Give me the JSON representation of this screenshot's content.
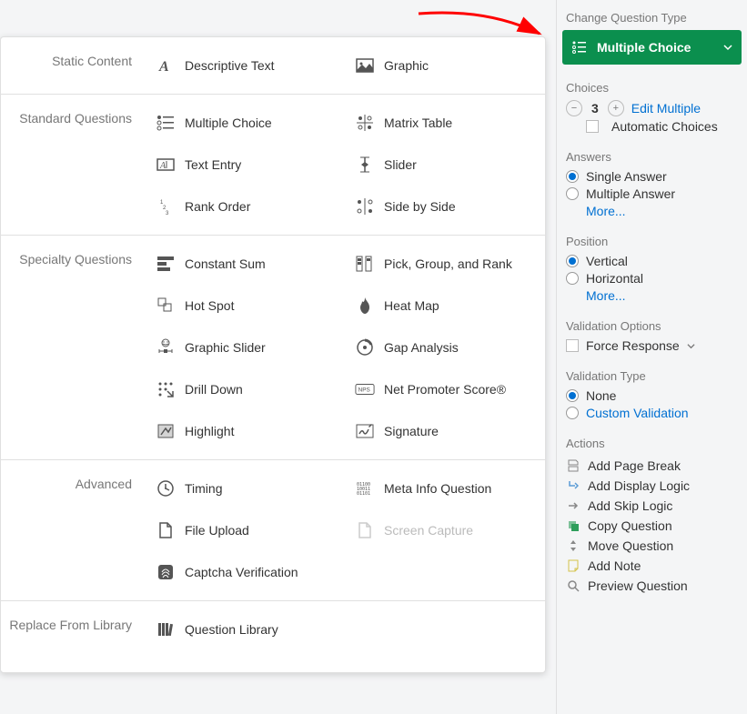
{
  "arrow": {
    "color": "#ff0000"
  },
  "popup": {
    "categories": [
      {
        "name": "static-content",
        "label": "Static Content",
        "options": [
          {
            "key": "descriptive-text",
            "label": "Descriptive Text",
            "icon": "text-icon"
          },
          {
            "key": "graphic",
            "label": "Graphic",
            "icon": "image-icon"
          }
        ]
      },
      {
        "name": "standard-questions",
        "label": "Standard Questions",
        "options": [
          {
            "key": "multiple-choice",
            "label": "Multiple Choice",
            "icon": "mc-icon"
          },
          {
            "key": "matrix-table",
            "label": "Matrix Table",
            "icon": "matrix-icon"
          },
          {
            "key": "text-entry",
            "label": "Text Entry",
            "icon": "textentry-icon"
          },
          {
            "key": "slider",
            "label": "Slider",
            "icon": "slider-icon"
          },
          {
            "key": "rank-order",
            "label": "Rank Order",
            "icon": "rank-icon"
          },
          {
            "key": "side-by-side",
            "label": "Side by Side",
            "icon": "sbs-icon"
          }
        ]
      },
      {
        "name": "specialty-questions",
        "label": "Specialty Questions",
        "options": [
          {
            "key": "constant-sum",
            "label": "Constant Sum",
            "icon": "bars-icon"
          },
          {
            "key": "pick-group-rank",
            "label": "Pick, Group, and Rank",
            "icon": "pgr-icon"
          },
          {
            "key": "hot-spot",
            "label": "Hot Spot",
            "icon": "hotspot-icon"
          },
          {
            "key": "heat-map",
            "label": "Heat Map",
            "icon": "flame-icon"
          },
          {
            "key": "graphic-slider",
            "label": "Graphic Slider",
            "icon": "gslider-icon"
          },
          {
            "key": "gap-analysis",
            "label": "Gap Analysis",
            "icon": "gap-icon"
          },
          {
            "key": "drill-down",
            "label": "Drill Down",
            "icon": "drill-icon"
          },
          {
            "key": "nps",
            "label": "Net Promoter Score®",
            "icon": "nps-icon"
          },
          {
            "key": "highlight",
            "label": "Highlight",
            "icon": "highlight-icon"
          },
          {
            "key": "signature",
            "label": "Signature",
            "icon": "signature-icon"
          }
        ]
      },
      {
        "name": "advanced",
        "label": "Advanced",
        "options": [
          {
            "key": "timing",
            "label": "Timing",
            "icon": "clock-icon"
          },
          {
            "key": "meta-info",
            "label": "Meta Info Question",
            "icon": "meta-icon"
          },
          {
            "key": "file-upload",
            "label": "File Upload",
            "icon": "file-icon"
          },
          {
            "key": "screen-capture",
            "label": "Screen Capture",
            "icon": "file-icon",
            "disabled": true
          },
          {
            "key": "captcha",
            "label": "Captcha Verification",
            "icon": "fingerprint-icon"
          }
        ]
      },
      {
        "name": "replace-from-library",
        "label": "Replace From Library",
        "options": [
          {
            "key": "question-library",
            "label": "Question Library",
            "icon": "library-icon"
          }
        ]
      }
    ]
  },
  "sidebar": {
    "title": "Change Question Type",
    "selected_type": "Multiple Choice",
    "choices": {
      "heading": "Choices",
      "count": "3",
      "edit_multiple": "Edit Multiple",
      "automatic": "Automatic Choices"
    },
    "answers": {
      "heading": "Answers",
      "options": [
        {
          "key": "single",
          "label": "Single Answer",
          "selected": true
        },
        {
          "key": "multiple",
          "label": "Multiple Answer",
          "selected": false
        }
      ],
      "more": "More..."
    },
    "position": {
      "heading": "Position",
      "options": [
        {
          "key": "vertical",
          "label": "Vertical",
          "selected": true
        },
        {
          "key": "horizontal",
          "label": "Horizontal",
          "selected": false
        }
      ],
      "more": "More..."
    },
    "validation_options": {
      "heading": "Validation Options",
      "force": "Force Response"
    },
    "validation_type": {
      "heading": "Validation Type",
      "options": [
        {
          "key": "none",
          "label": "None",
          "selected": true,
          "link": false
        },
        {
          "key": "custom",
          "label": "Custom Validation",
          "selected": false,
          "link": true
        }
      ]
    },
    "actions": {
      "heading": "Actions",
      "items": [
        {
          "key": "page-break",
          "label": "Add Page Break",
          "icon": "pagebreak-icon"
        },
        {
          "key": "display-logic",
          "label": "Add Display Logic",
          "icon": "displaylogic-icon",
          "color": "blue"
        },
        {
          "key": "skip-logic",
          "label": "Add Skip Logic",
          "icon": "skiplogic-icon"
        },
        {
          "key": "copy",
          "label": "Copy Question",
          "icon": "copy-icon",
          "color": "green"
        },
        {
          "key": "move",
          "label": "Move Question",
          "icon": "move-icon"
        },
        {
          "key": "note",
          "label": "Add Note",
          "icon": "note-icon",
          "color": "yellow"
        },
        {
          "key": "preview",
          "label": "Preview Question",
          "icon": "magnifier-icon"
        }
      ]
    }
  }
}
